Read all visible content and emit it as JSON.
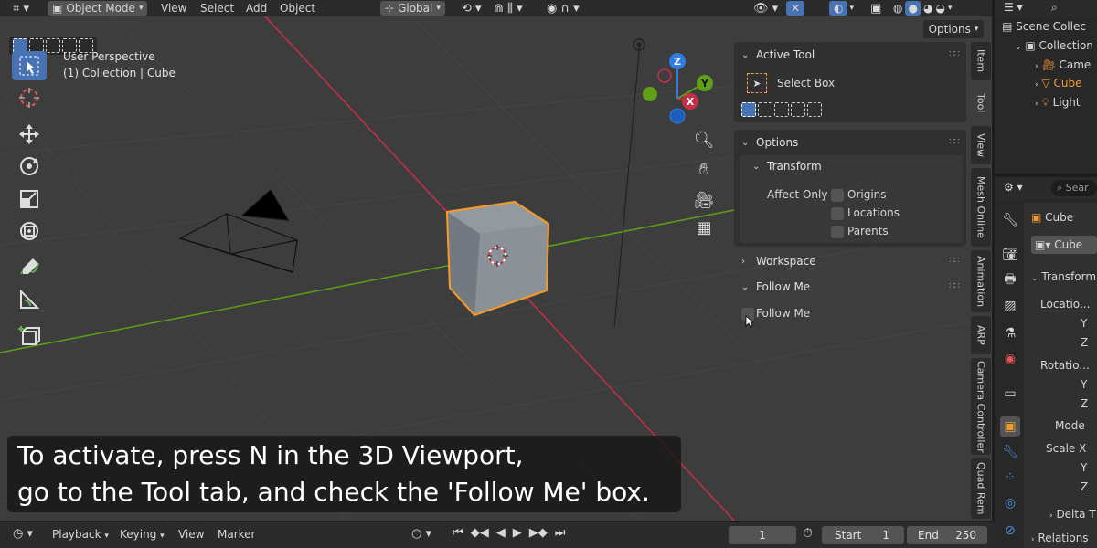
{
  "header": {
    "mode": "Object Mode",
    "menus": [
      "View",
      "Select",
      "Add",
      "Object"
    ],
    "orientation": "Global",
    "options_label": "Options"
  },
  "viewport": {
    "perspective_label": "User Perspective",
    "collection_label": "(1) Collection | Cube"
  },
  "gizmo": {
    "z": "Z",
    "y": "Y",
    "x": "X"
  },
  "npanel": {
    "active_tool": {
      "title": "Active Tool",
      "tool_name": "Select Box"
    },
    "options": {
      "title": "Options",
      "transform": "Transform",
      "affect_only": "Affect Only",
      "origins": "Origins",
      "locations": "Locations",
      "parents": "Parents"
    },
    "workspace": "Workspace",
    "follow_me": {
      "title": "Follow Me",
      "checkbox_label": "Follow Me"
    }
  },
  "tabs": [
    "Item",
    "Tool",
    "View",
    "Mesh Online",
    "Animation",
    "ARP",
    "Camera Controller",
    "Quad Rem"
  ],
  "outliner": {
    "scene": "Scene Collec",
    "collection": "Collection",
    "items": [
      "Came",
      "Cube",
      "Light"
    ]
  },
  "properties": {
    "search_placeholder": "Sear",
    "object_name": "Cube",
    "datablock": "Cube",
    "transform": "Transform",
    "location": "Locatio...",
    "rotation": "Rotatio...",
    "mode": "Mode",
    "scale": "Scale X",
    "y": "Y",
    "z": "Z",
    "delta": "Delta T",
    "relations": "Relations"
  },
  "subtitle": {
    "line1": "To activate, press N in the 3D Viewport,",
    "line2": "go to the Tool tab, and check the 'Follow Me' box."
  },
  "timeline": {
    "menus": [
      "Playback",
      "Keying",
      "View",
      "Marker"
    ],
    "current_frame": "1",
    "start_label": "Start",
    "start_value": "1",
    "end_label": "End",
    "end_value": "250"
  },
  "colors": {
    "accent": "#4772b3",
    "selection": "#f49a2b",
    "x_axis": "#c53048",
    "y_axis": "#5fa017",
    "z_axis": "#2f7de0"
  }
}
